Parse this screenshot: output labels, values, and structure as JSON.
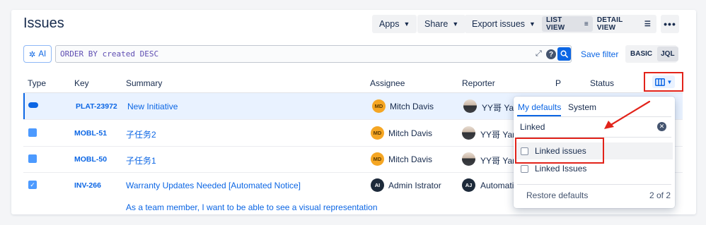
{
  "header": {
    "title": "Issues",
    "apps_label": "Apps",
    "share_label": "Share",
    "export_label": "Export issues",
    "list_view_label": "LIST VIEW",
    "detail_view_label": "DETAIL VIEW",
    "more_label": "•••"
  },
  "search": {
    "ai_label": "AI",
    "jql": "ORDER BY created DESC",
    "help": "?",
    "save_filter_label": "Save filter",
    "basic_label": "BASIC",
    "jql_label": "JQL"
  },
  "table": {
    "columns": [
      "Type",
      "Key",
      "Summary",
      "Assignee",
      "Reporter",
      "P",
      "Status"
    ],
    "rows": [
      {
        "type_icon": "initiative-icon",
        "key": "PLAT-23972",
        "summary": "New Initiative",
        "assignee_initials": "MD",
        "assignee": "Mitch Davis",
        "reporter": "YY哥 Yan",
        "selected": true
      },
      {
        "type_icon": "subtask-icon",
        "key": "MOBL-51",
        "summary": "子任务2",
        "assignee_initials": "MD",
        "assignee": "Mitch Davis",
        "reporter": "YY哥 Yan",
        "selected": false
      },
      {
        "type_icon": "subtask-icon",
        "key": "MOBL-50",
        "summary": "子任务1",
        "assignee_initials": "MD",
        "assignee": "Mitch Davis",
        "reporter": "YY哥 Yan",
        "selected": false
      },
      {
        "type_icon": "task-icon",
        "key": "INV-266",
        "summary": "Warranty Updates Needed [Automated Notice]",
        "assignee_initials": "AI",
        "assignee": "Admin Istrator",
        "reporter_initials": "AJ",
        "reporter": "Automati",
        "selected": false
      }
    ],
    "partial_summary": "As a team member, I want to be able to see a visual representation"
  },
  "column_picker": {
    "tabs": [
      "My defaults",
      "System"
    ],
    "search_value": "Linked",
    "options": [
      "Linked issues",
      "Linked Issues"
    ],
    "restore_label": "Restore defaults",
    "count": "2 of 2"
  },
  "colors": {
    "brand_blue": "#0c66e4",
    "annotation_red": "#e2231a",
    "avatar_orange": "#f5a623",
    "avatar_dark": "#1d2a3a"
  }
}
